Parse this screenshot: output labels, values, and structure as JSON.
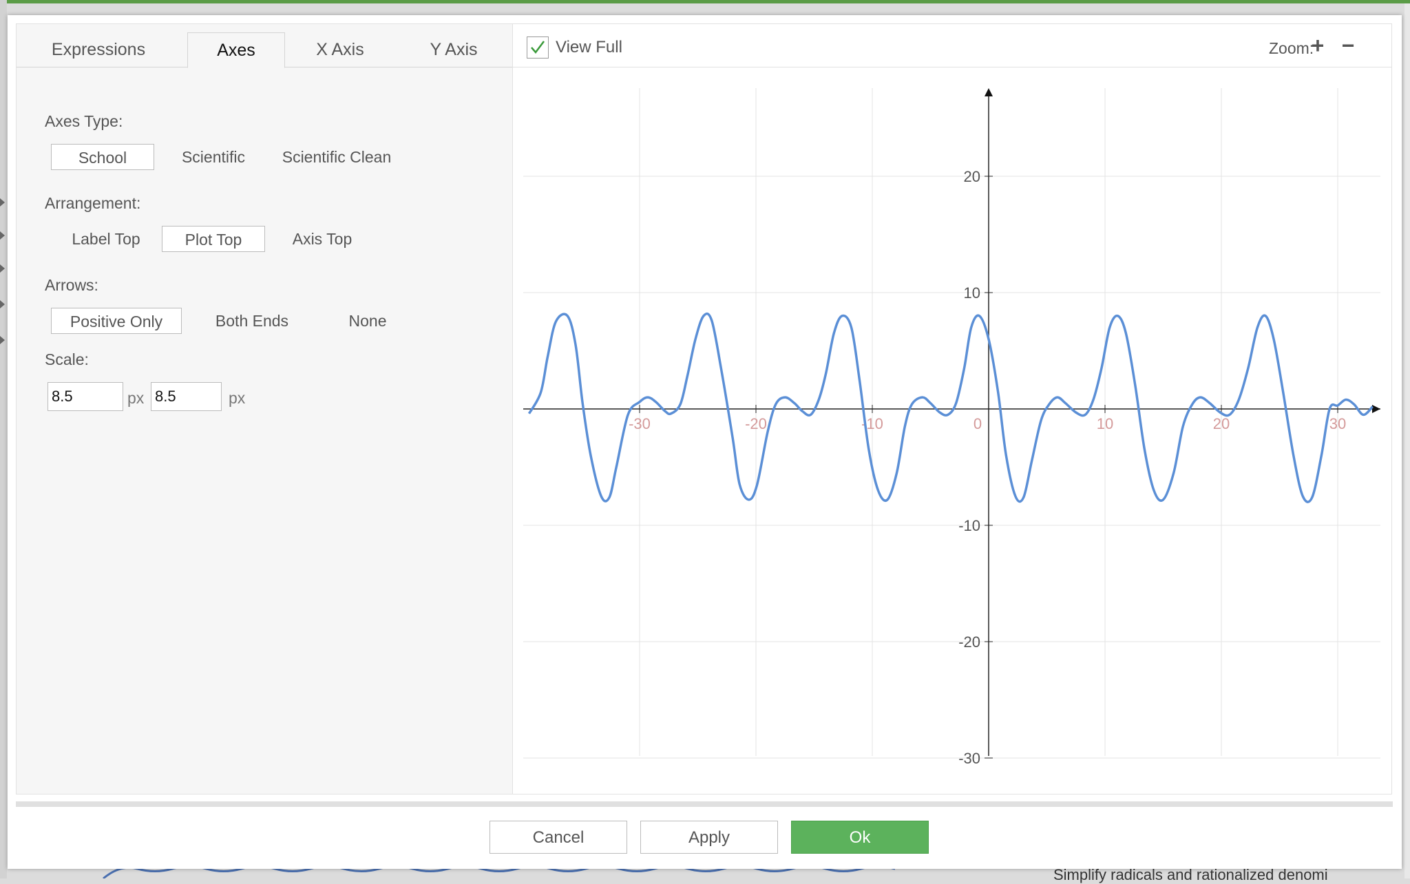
{
  "dialog": {
    "tabs": [
      {
        "label": "Expressions",
        "active": false
      },
      {
        "label": "Axes",
        "active": true
      },
      {
        "label": "X Axis",
        "active": false
      },
      {
        "label": "Y Axis",
        "active": false
      }
    ],
    "axes_type": {
      "label": "Axes Type:",
      "options": [
        "School",
        "Scientific",
        "Scientific Clean"
      ],
      "selected": "School"
    },
    "arrangement": {
      "label": "Arrangement:",
      "options": [
        "Label Top",
        "Plot Top",
        "Axis Top"
      ],
      "selected": "Plot Top"
    },
    "arrows": {
      "label": "Arrows:",
      "options": [
        "Positive Only",
        "Both Ends",
        "None"
      ],
      "selected": "Positive Only"
    },
    "scale": {
      "label": "Scale:",
      "x_value": "8.5",
      "y_value": "8.5",
      "unit": "px"
    },
    "toolbar": {
      "view_full_label": "View Full",
      "view_full_checked": true,
      "zoom_label": "Zoom:",
      "zoom_in": "+",
      "zoom_out": "−"
    },
    "buttons": {
      "cancel": "Cancel",
      "apply": "Apply",
      "ok": "Ok"
    }
  },
  "background": {
    "partial_text": "Simplify radicals and rationalized denomi"
  },
  "colors": {
    "curve": "#5b8fd6",
    "ok_button": "#5cb25c",
    "checkmark": "#3a9a3a",
    "x_tick_labels": "#d49a9a"
  },
  "chart_data": {
    "type": "line",
    "xlim": [
      -39.5,
      33
    ],
    "ylim": [
      -30,
      28
    ],
    "x_ticks": [
      -30,
      -20,
      -10,
      0,
      10,
      20,
      30
    ],
    "x_tick_labels": [
      "-30",
      "-20",
      "-10",
      "0",
      "10",
      "20",
      "30"
    ],
    "y_ticks": [
      20,
      10,
      -10,
      -20,
      -30
    ],
    "y_tick_labels": [
      "20",
      "10",
      "-10",
      "-20",
      "-30"
    ],
    "grid": true,
    "arrows": "positive only",
    "series": [
      {
        "x": [
          -39.5,
          -38.5,
          -37.9,
          -37.2,
          -36.2,
          -35.5,
          -34.9,
          -34.2,
          -33.3,
          -32.6,
          -32.0,
          -31.0,
          -30.0,
          -29.3,
          -28.6,
          -27.8,
          -27.3,
          -26.5,
          -25.9,
          -25.2,
          -24.5,
          -23.8,
          -23.0,
          -22.0,
          -21.4,
          -20.6,
          -19.9,
          -19.0,
          -18.3,
          -17.5,
          -16.7,
          -16.0,
          -15.3,
          -14.6,
          -14.0,
          -13.3,
          -12.6,
          -11.8,
          -11.1,
          -10.3,
          -9.5,
          -8.7,
          -7.9,
          -7.2,
          -6.6,
          -5.7,
          -5.0,
          -4.2,
          -3.5,
          -2.8,
          -2.1,
          -1.5,
          -0.8,
          0.0,
          0.8,
          1.5,
          2.3,
          3.0,
          3.7,
          4.5,
          5.2,
          5.9,
          6.6,
          7.5,
          8.3,
          9.0,
          9.7,
          10.4,
          11.1,
          11.8,
          12.6,
          13.4,
          14.2,
          15.0,
          15.9,
          16.7,
          17.5,
          18.2,
          19.0,
          19.9,
          20.7,
          21.5,
          22.3,
          23.1,
          23.8,
          24.5,
          25.3,
          26.2,
          27.0,
          27.8,
          28.6,
          29.3,
          30.0,
          30.7,
          31.4,
          32.2,
          33.0
        ],
        "y": [
          -0.4,
          1.4,
          4.5,
          7.5,
          8.0,
          5.5,
          0.5,
          -4.0,
          -7.5,
          -7.6,
          -5.0,
          -0.5,
          0.6,
          1.0,
          0.6,
          -0.2,
          -0.4,
          0.4,
          2.8,
          6.0,
          8.0,
          7.6,
          3.5,
          -2.5,
          -6.5,
          -7.8,
          -6.5,
          -2.0,
          0.4,
          1.0,
          0.5,
          -0.2,
          -0.5,
          0.8,
          3.0,
          6.5,
          8.0,
          7.0,
          2.5,
          -3.5,
          -7.0,
          -7.8,
          -5.5,
          -1.5,
          0.4,
          1.0,
          0.5,
          -0.3,
          -0.5,
          0.5,
          3.5,
          7.0,
          8.0,
          6.0,
          1.5,
          -4.0,
          -7.5,
          -7.6,
          -4.5,
          -1.0,
          0.4,
          1.0,
          0.5,
          -0.3,
          -0.5,
          0.8,
          3.5,
          7.0,
          8.0,
          6.5,
          2.0,
          -3.5,
          -7.0,
          -7.8,
          -5.5,
          -1.5,
          0.4,
          1.0,
          0.5,
          -0.3,
          -0.5,
          0.8,
          3.5,
          7.0,
          8.0,
          6.0,
          1.5,
          -4.0,
          -7.5,
          -7.6,
          -4.0,
          0.0,
          0.3,
          0.8,
          0.4,
          -0.5,
          0.2
        ]
      }
    ]
  }
}
